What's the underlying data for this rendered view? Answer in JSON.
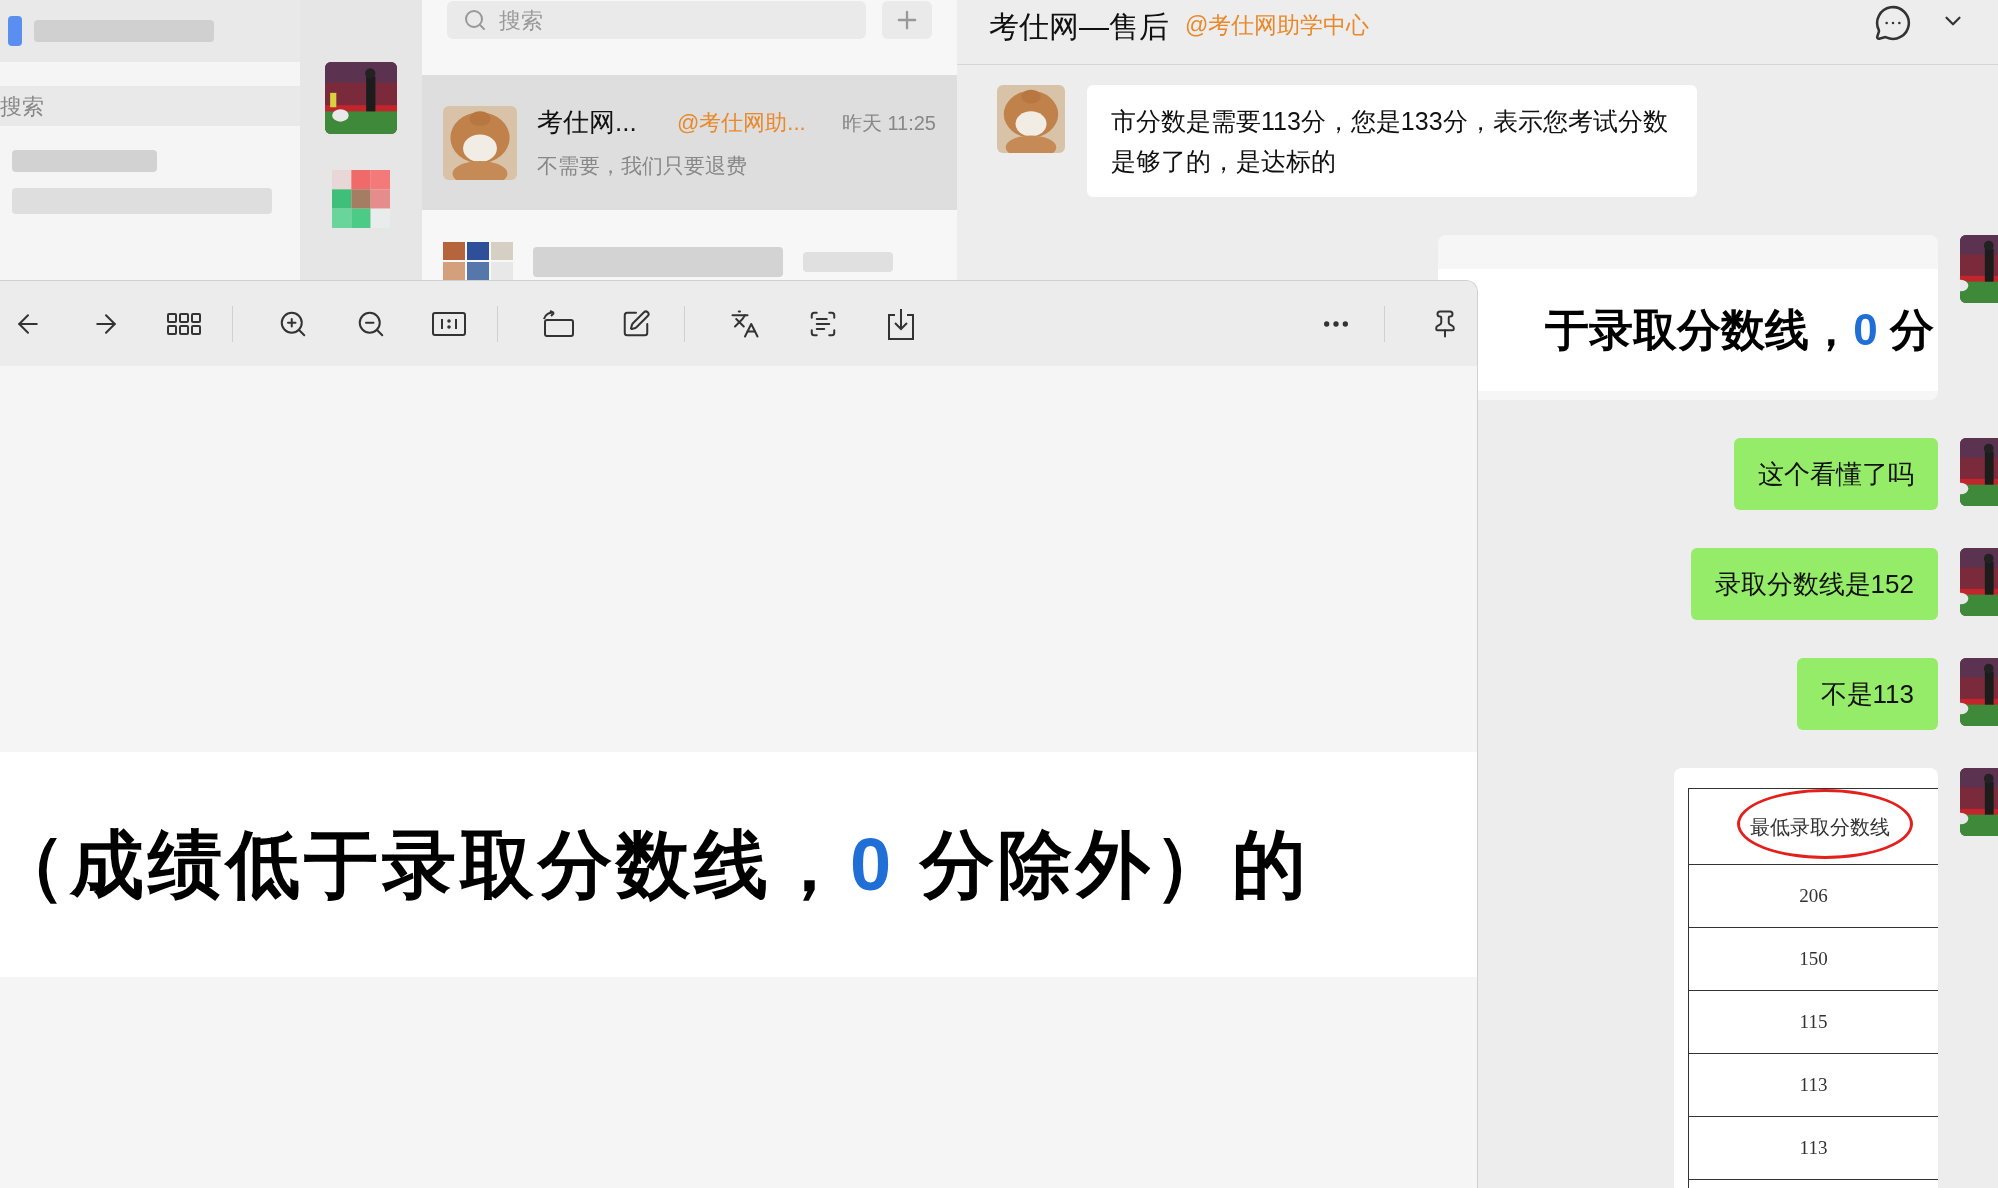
{
  "left_window": {
    "search_placeholder": "搜索"
  },
  "chat_list": {
    "search": {
      "placeholder": "搜索"
    },
    "chats": [
      {
        "name": "考仕网...",
        "tag": "@考仕网助...",
        "time": "昨天 11:25",
        "preview": "不需要，我们只要退费",
        "selected": true
      }
    ]
  },
  "chat": {
    "title": "考仕网—售后",
    "tag": "@考仕网助学中心",
    "messages": [
      {
        "kind": "text",
        "mine": false,
        "text": "市分数是需要113分，您是133分，表示您考试分数是够了的，是达标的"
      },
      {
        "kind": "image_text",
        "mine": true,
        "before": "于录取分数线，",
        "highlight": "0",
        "after": "分"
      },
      {
        "kind": "text",
        "mine": true,
        "text": "这个看懂了吗"
      },
      {
        "kind": "text",
        "mine": true,
        "text": "录取分数线是152"
      },
      {
        "kind": "text",
        "mine": true,
        "text": "不是113"
      },
      {
        "kind": "table",
        "mine": true,
        "header": "最低录取分数线",
        "rows": [
          "206",
          "150",
          "115",
          "113",
          "113"
        ]
      }
    ]
  },
  "viewer": {
    "image_text": {
      "before": "（成绩低于录取分数线，",
      "highlight": "0",
      "after": "分除外）的"
    }
  }
}
